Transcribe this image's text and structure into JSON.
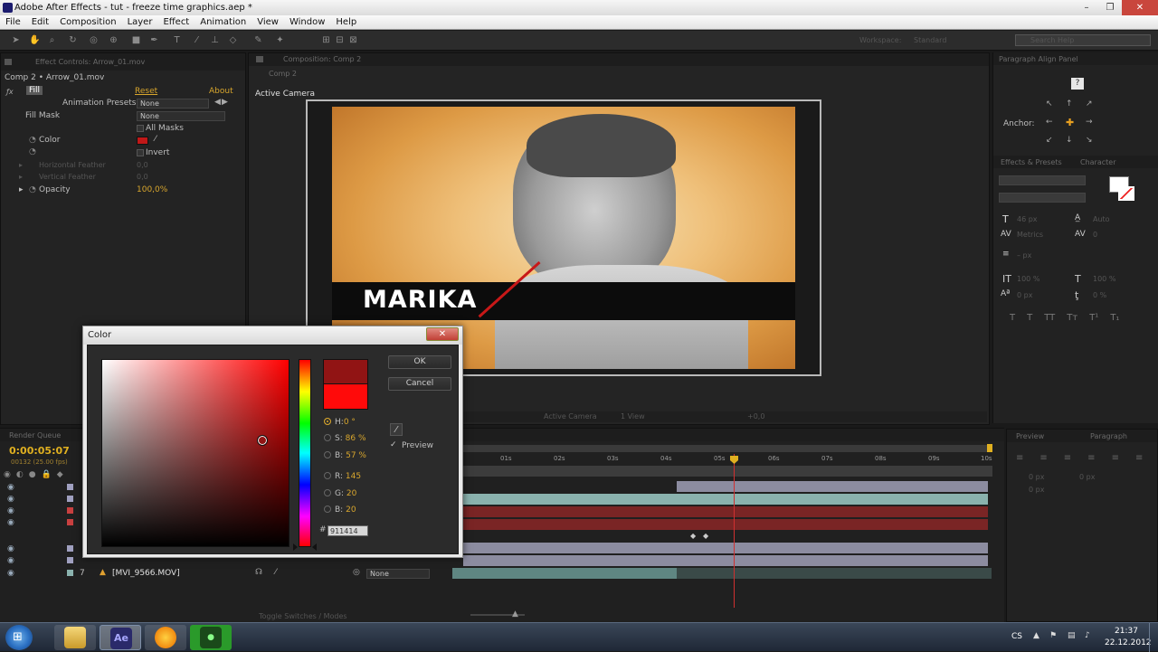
{
  "window": {
    "title": "Adobe After Effects - tut - freeze time graphics.aep *",
    "minimize": "–",
    "maximize": "❐",
    "close": "✕"
  },
  "menu": [
    "File",
    "Edit",
    "Composition",
    "Layer",
    "Effect",
    "Animation",
    "View",
    "Window",
    "Help"
  ],
  "effect_controls": {
    "tab_label": "Effect Controls: Arrow_01.mov",
    "layer_path": "Comp 2 • Arrow_01.mov",
    "effect_name": "Fill",
    "reset": "Reset",
    "about": "About",
    "animation_presets_label": "Animation Presets:",
    "animation_presets_value": "None",
    "fill_mask_label": "Fill Mask",
    "fill_mask_value": "None",
    "all_masks": "All Masks",
    "color_label": "Color",
    "invert": "Invert",
    "horizontal_feather": "Horizontal Feather",
    "horizontal_feather_value": "0,0",
    "vertical_feather": "Vertical Feather",
    "vertical_feather_value": "0,0",
    "opacity_label": "Opacity",
    "opacity_value": "100,0%",
    "color_swatch": "#c01818"
  },
  "composition": {
    "tab_label": "Composition: Comp 2",
    "sub_tab": "Comp 2",
    "view_label": "Active Camera",
    "overlay_text": "MARIKA",
    "footer_camera": "Active Camera",
    "footer_views": "1 View",
    "footer_offset": "+0,0"
  },
  "color_dialog": {
    "title": "Color",
    "close": "✕",
    "ok": "OK",
    "cancel": "Cancel",
    "preview": "Preview",
    "h_label": "H:",
    "h_value": "0 °",
    "s_label": "S:",
    "s_value": "86 %",
    "b_label": "B:",
    "b_value": "57 %",
    "r_label": "R:",
    "r_value": "145",
    "g_label": "G:",
    "g_value": "20",
    "bb_label": "B:",
    "bb_value": "20",
    "hex_label": "#",
    "hex_value": "911414",
    "new_color": "#911414",
    "old_color": "#ff0a0a"
  },
  "timeline": {
    "tab_label": "Render Queue",
    "timecode": "0:00:05:07",
    "frames": "00132 (25.00 fps)",
    "ruler": [
      "01s",
      "02s",
      "03s",
      "04s",
      "05s",
      "06s",
      "07s",
      "08s",
      "09s",
      "10s"
    ],
    "layer_number": "7",
    "layer_name": "[MVI_9566.MOV]",
    "parent_value": "None",
    "toggle_label": "Toggle Switches / Modes",
    "highlight_color": "#8ab2ae",
    "red_track_color": "#7a2525"
  },
  "right_panels": {
    "tab_paragraph_align": "Paragraph Align Panel",
    "anchor_label": "Anchor:",
    "question": "?",
    "tab_effects": "Effects & Presets",
    "tab_character": "Character",
    "char_size": "46 px",
    "char_leading": "Auto",
    "char_tracking": "Metrics",
    "char_kerning": "0",
    "char_line": "– px",
    "char_scale_v": "100 %",
    "char_scale_h": "100 %",
    "char_baseline": "0 px",
    "char_tsume": "0 %",
    "tab_preview": "Preview",
    "tab_paragraph": "Paragraph",
    "para_indent_1": "0 px",
    "para_indent_2": "0 px",
    "para_indent_3": "0 px"
  },
  "workspace": {
    "label": "Workspace:",
    "value": "Standard",
    "search_placeholder": "Search Help"
  },
  "taskbar": {
    "language": "CS",
    "time": "21:37",
    "date": "22.12.2012",
    "ae_label": "Ae"
  }
}
